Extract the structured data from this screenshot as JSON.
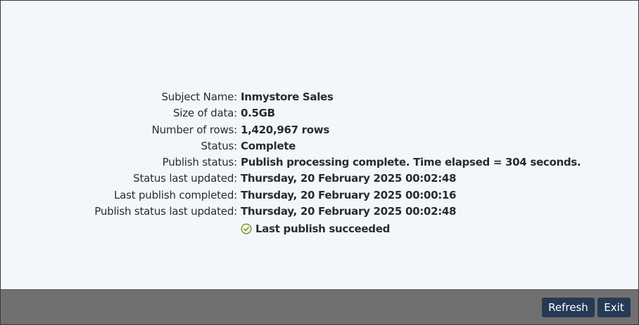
{
  "details": [
    {
      "label": "Subject Name:",
      "value": "Inmystore Sales"
    },
    {
      "label": "Size of data:",
      "value": "0.5GB"
    },
    {
      "label": "Number of rows:",
      "value": "1,420,967 rows"
    },
    {
      "label": "Status:",
      "value": "Complete"
    },
    {
      "label": "Publish status:",
      "value": "Publish processing complete. Time elapsed = 304 seconds."
    },
    {
      "label": "Status last updated:",
      "value": "Thursday, 20 February 2025 00:02:48"
    },
    {
      "label": "Last publish completed:",
      "value": "Thursday, 20 February 2025 00:00:16"
    },
    {
      "label": "Publish status last updated:",
      "value": "Thursday, 20 February 2025 00:02:48"
    }
  ],
  "result": {
    "icon": "check-circle-icon",
    "text": "Last publish succeeded",
    "icon_color": "#7a9a1a"
  },
  "footer": {
    "refresh_label": "Refresh",
    "exit_label": "Exit",
    "button_color": "#253a55",
    "bar_color": "#707070"
  }
}
